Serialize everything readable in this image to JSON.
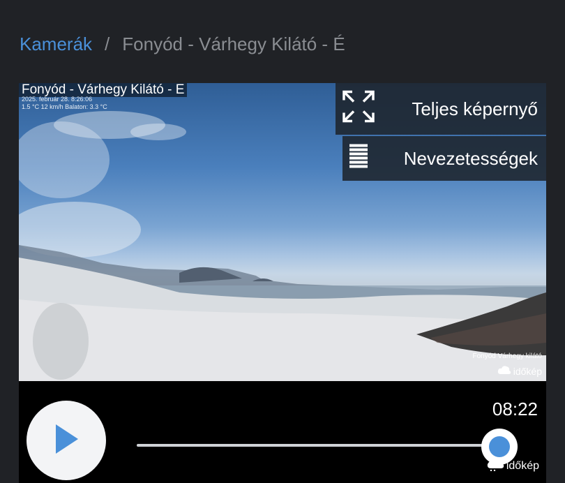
{
  "breadcrumb": {
    "root": "Kamerák",
    "separator": "/",
    "current": "Fonyód - Várhegy Kilátó - É"
  },
  "camera": {
    "overlay_title": "Fonyód - Várhegy Kilátó - E",
    "overlay_meta_line1": "2025. február 28. 8:26:06",
    "overlay_meta_line2": "1.5 °C 12 km/h Balaton: 3.3 °C",
    "fullscreen_label": "Teljes képernyő",
    "fullscreen_icon": "expand-icon",
    "poi_label": "Nevezetességek",
    "poi_icon": "list-icon",
    "caption": "Fonyód Várhegy kilátó",
    "logo": "időkép"
  },
  "player": {
    "time": "08:22",
    "progress": 0.955,
    "play_icon": "play-icon",
    "accent": "#4a90d9",
    "watermark": "időkép"
  }
}
